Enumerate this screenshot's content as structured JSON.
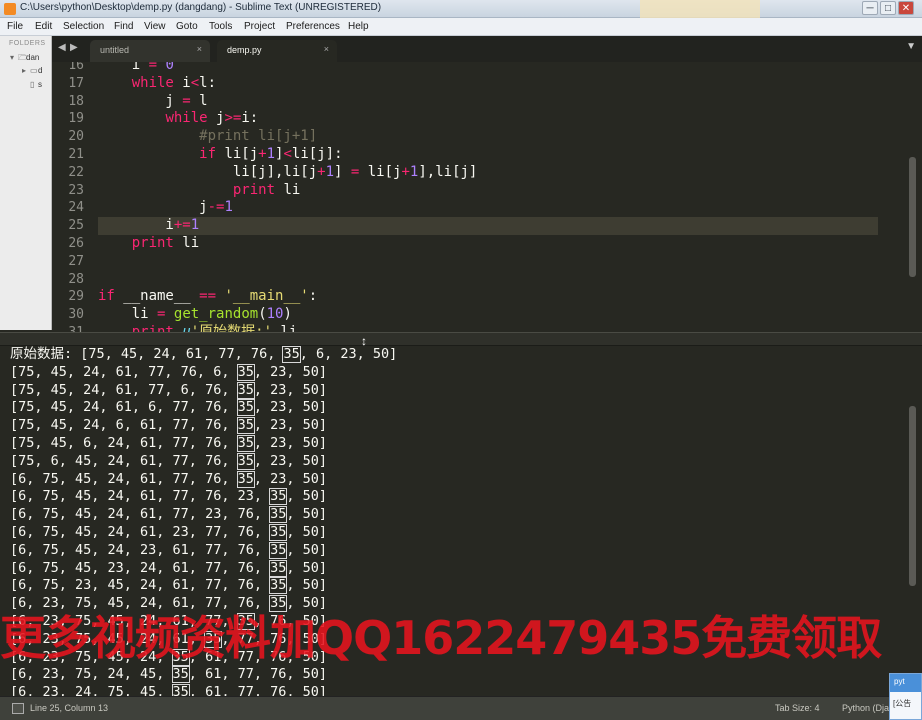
{
  "window": {
    "title": "C:\\Users\\python\\Desktop\\demp.py (dangdang) - Sublime Text (UNREGISTERED)",
    "minimize": "─",
    "maximize": "□",
    "close": "✕"
  },
  "menu": [
    "File",
    "Edit",
    "Selection",
    "Find",
    "View",
    "Goto",
    "Tools",
    "Project",
    "Preferences",
    "Help"
  ],
  "sidebar": {
    "header": "FOLDERS",
    "items": [
      "dan",
      "d",
      "s"
    ]
  },
  "tabs": [
    {
      "label": "untitled",
      "close": "×"
    },
    {
      "label": "demp.py",
      "close": "×"
    }
  ],
  "tab_nav": {
    "left": "◀",
    "right": "▶",
    "dropdown": "▼"
  },
  "editor": {
    "lines": [
      {
        "num": "16",
        "code": "    i = 0",
        "comment": false
      },
      {
        "num": "17",
        "code": "    while i<l:",
        "comment": false
      },
      {
        "num": "18",
        "code": "        j = l",
        "comment": false
      },
      {
        "num": "19",
        "code": "        while j>=i:",
        "comment": false
      },
      {
        "num": "20",
        "code": "            #print li[j+1]",
        "comment": true
      },
      {
        "num": "21",
        "code": "            if li[j+1]<li[j]:",
        "comment": false
      },
      {
        "num": "22",
        "code": "                li[j],li[j+1] = li[j+1],li[j]",
        "comment": false
      },
      {
        "num": "23",
        "code": "                print li",
        "comment": false
      },
      {
        "num": "24",
        "code": "            j-=1",
        "comment": false
      },
      {
        "num": "25",
        "code": "        i+=1",
        "comment": false,
        "current": true
      },
      {
        "num": "26",
        "code": "    print li",
        "comment": false
      },
      {
        "num": "27",
        "code": "",
        "comment": false
      },
      {
        "num": "28",
        "code": "",
        "comment": false
      },
      {
        "num": "29",
        "code": "if __name__ == '__main__':",
        "comment": false
      },
      {
        "num": "30",
        "code": "    li = get_random(10)",
        "comment": false
      },
      {
        "num": "31",
        "code": "    print u'原始数据:',li",
        "comment": false
      }
    ]
  },
  "colors": {
    "keyword": "#f92672",
    "function": "#a6e22e",
    "string": "#e6db74",
    "number": "#ae81ff",
    "comment": "#75715e",
    "watermark": "#e8141e"
  },
  "output": {
    "lines": [
      "原始数据: [75, 45, 24, 61, 77, 76, 35, 6, 23, 50]",
      "[75, 45, 24, 61, 77, 76, 6, 35, 23, 50]",
      "[75, 45, 24, 61, 77, 6, 76, 35, 23, 50]",
      "[75, 45, 24, 61, 6, 77, 76, 35, 23, 50]",
      "[75, 45, 24, 6, 61, 77, 76, 35, 23, 50]",
      "[75, 45, 6, 24, 61, 77, 76, 35, 23, 50]",
      "[75, 6, 45, 24, 61, 77, 76, 35, 23, 50]",
      "[6, 75, 45, 24, 61, 77, 76, 35, 23, 50]",
      "[6, 75, 45, 24, 61, 77, 76, 23, 35, 50]",
      "[6, 75, 45, 24, 61, 77, 23, 76, 35, 50]",
      "[6, 75, 45, 24, 61, 23, 77, 76, 35, 50]",
      "[6, 75, 45, 24, 23, 61, 77, 76, 35, 50]",
      "[6, 75, 45, 23, 24, 61, 77, 76, 35, 50]",
      "[6, 75, 23, 45, 24, 61, 77, 76, 35, 50]",
      "[6, 23, 75, 45, 24, 61, 77, 76, 35, 50]",
      "[6, 23, 75, 45, 24, 61, 77, 35, 76, 50]",
      "[6, 23, 75, 45, 24, 61, 35, 77, 76, 50]",
      "[6, 23, 75, 45, 24, 35, 61, 77, 76, 50]",
      "[6, 23, 75, 24, 45, 35, 61, 77, 76, 50]",
      "[6, 23, 24, 75, 45, 35, 61, 77, 76, 50]"
    ]
  },
  "watermark": "更多视频资料加QQ1622479435免费领取",
  "status": {
    "position": "Line 25, Column 13",
    "tab_size": "Tab Size: 4",
    "syntax": "Python (Djan"
  },
  "popup": {
    "head": "pyt",
    "text": "[公告"
  }
}
